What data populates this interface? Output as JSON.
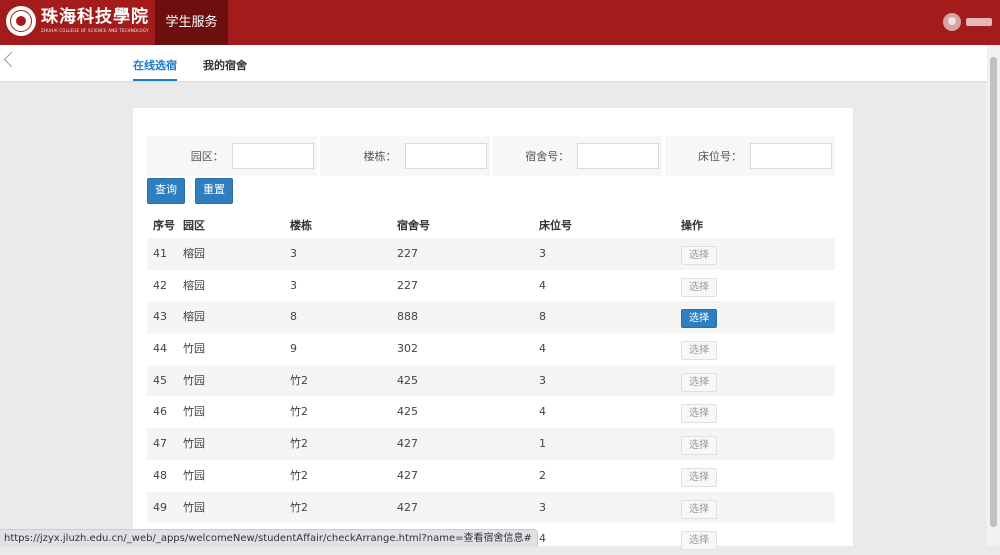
{
  "header": {
    "logo_cn": "珠海科技學院",
    "logo_en": "ZHUHAI COLLEGE OF SCIENCE AND TECHNOLOGY",
    "nav_tab": "学生服务",
    "brand_color": "#a41b1c"
  },
  "subnav": {
    "tabs": [
      {
        "label": "在线选宿",
        "active": true
      },
      {
        "label": "我的宿舍",
        "active": false
      }
    ]
  },
  "filters": [
    {
      "label": "园区：",
      "value": ""
    },
    {
      "label": "楼栋：",
      "value": ""
    },
    {
      "label": "宿舍号：",
      "value": ""
    },
    {
      "label": "床位号：",
      "value": ""
    }
  ],
  "buttons": {
    "query": "查询",
    "reset": "重置"
  },
  "table": {
    "columns": [
      "序号",
      "园区",
      "楼栋",
      "宿舍号",
      "床位号",
      "操作"
    ],
    "action_label": "选择",
    "rows": [
      {
        "no": "41",
        "park": "榕园",
        "building": "3",
        "room": "227",
        "bed": "3",
        "selectable": false
      },
      {
        "no": "42",
        "park": "榕园",
        "building": "3",
        "room": "227",
        "bed": "4",
        "selectable": false
      },
      {
        "no": "43",
        "park": "榕园",
        "building": "8",
        "room": "888",
        "bed": "8",
        "selectable": true
      },
      {
        "no": "44",
        "park": "竹园",
        "building": "9",
        "room": "302",
        "bed": "4",
        "selectable": false
      },
      {
        "no": "45",
        "park": "竹园",
        "building": "竹2",
        "room": "425",
        "bed": "3",
        "selectable": false
      },
      {
        "no": "46",
        "park": "竹园",
        "building": "竹2",
        "room": "425",
        "bed": "4",
        "selectable": false
      },
      {
        "no": "47",
        "park": "竹园",
        "building": "竹2",
        "room": "427",
        "bed": "1",
        "selectable": false
      },
      {
        "no": "48",
        "park": "竹园",
        "building": "竹2",
        "room": "427",
        "bed": "2",
        "selectable": false
      },
      {
        "no": "49",
        "park": "竹园",
        "building": "竹2",
        "room": "427",
        "bed": "3",
        "selectable": false
      },
      {
        "no": "",
        "park": "",
        "building": "",
        "room": "",
        "bed": "4",
        "selectable": false
      }
    ]
  },
  "status_bar": {
    "url": "https://jzyx.jluzh.edu.cn/_web/_apps/welcomeNew/studentAffair/checkArrange.html?name=查看宿舍信息#"
  }
}
